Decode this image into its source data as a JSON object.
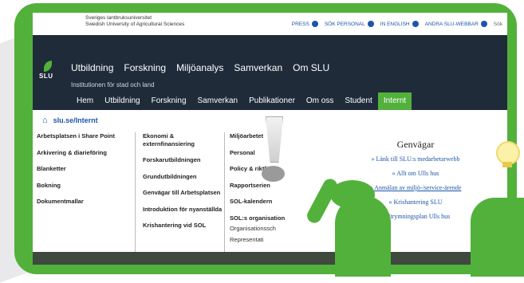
{
  "university": {
    "name_sv": "Sveriges lantbruksuniversitet",
    "name_en": "Swedish University of Agricultural Sciences",
    "logo_text": "SLU"
  },
  "util_links": [
    {
      "label": "PRESS",
      "icon": "eye-icon"
    },
    {
      "label": "SÖK PERSONAL",
      "icon": "people-icon"
    },
    {
      "label": "IN ENGLISH",
      "icon": "globe-icon"
    },
    {
      "label": "ANDRA SLU-WEBBAR",
      "icon": "share-icon"
    }
  ],
  "search_placeholder": "Sök",
  "main_nav": [
    "Utbildning",
    "Forskning",
    "Miljöanalys",
    "Samverkan",
    "Om SLU"
  ],
  "subtitle": "Institutionen för stad och land",
  "sub_nav": [
    "Hem",
    "Utbildning",
    "Forskning",
    "Samverkan",
    "Publikationer",
    "Om oss",
    "Student",
    "Internt"
  ],
  "active_sub_nav": "Internt",
  "breadcrumb": "slu.se/Internt",
  "col1": [
    "Arbetsplatsen i Share Point",
    "Arkivering & diarieföring",
    "Blanketter",
    "Bokning",
    "Dokumentmallar"
  ],
  "col2": [
    "Ekonomi & externfinansiering",
    "Forskarutbildningen",
    "Grundutbildningen",
    "Genvägar till Arbetsplatsen",
    "Introduktion för nyanställda",
    "Krishantering vid SOL"
  ],
  "col3_bold": [
    "Miljöarbetet",
    "Personal",
    "Policy & riktlinjer",
    "Rapportserien",
    "SOL-kalendern",
    "SOL:s organisation"
  ],
  "col3_thin": [
    "Organisationssch",
    "Representati"
  ],
  "shortcuts": {
    "title": "Genvägar",
    "links": [
      "» Länk till SLU:s medarbetarwebb",
      "» Allt om Ulls hus",
      "» Anmälan av miljö-/service-ärende",
      "» Krishantering SLU",
      "» Utrymningsplan Ulls hus"
    ]
  },
  "colors": {
    "brand_green": "#52b13b",
    "nav_dark": "#1f2b39",
    "link_blue": "#1e55a8"
  }
}
